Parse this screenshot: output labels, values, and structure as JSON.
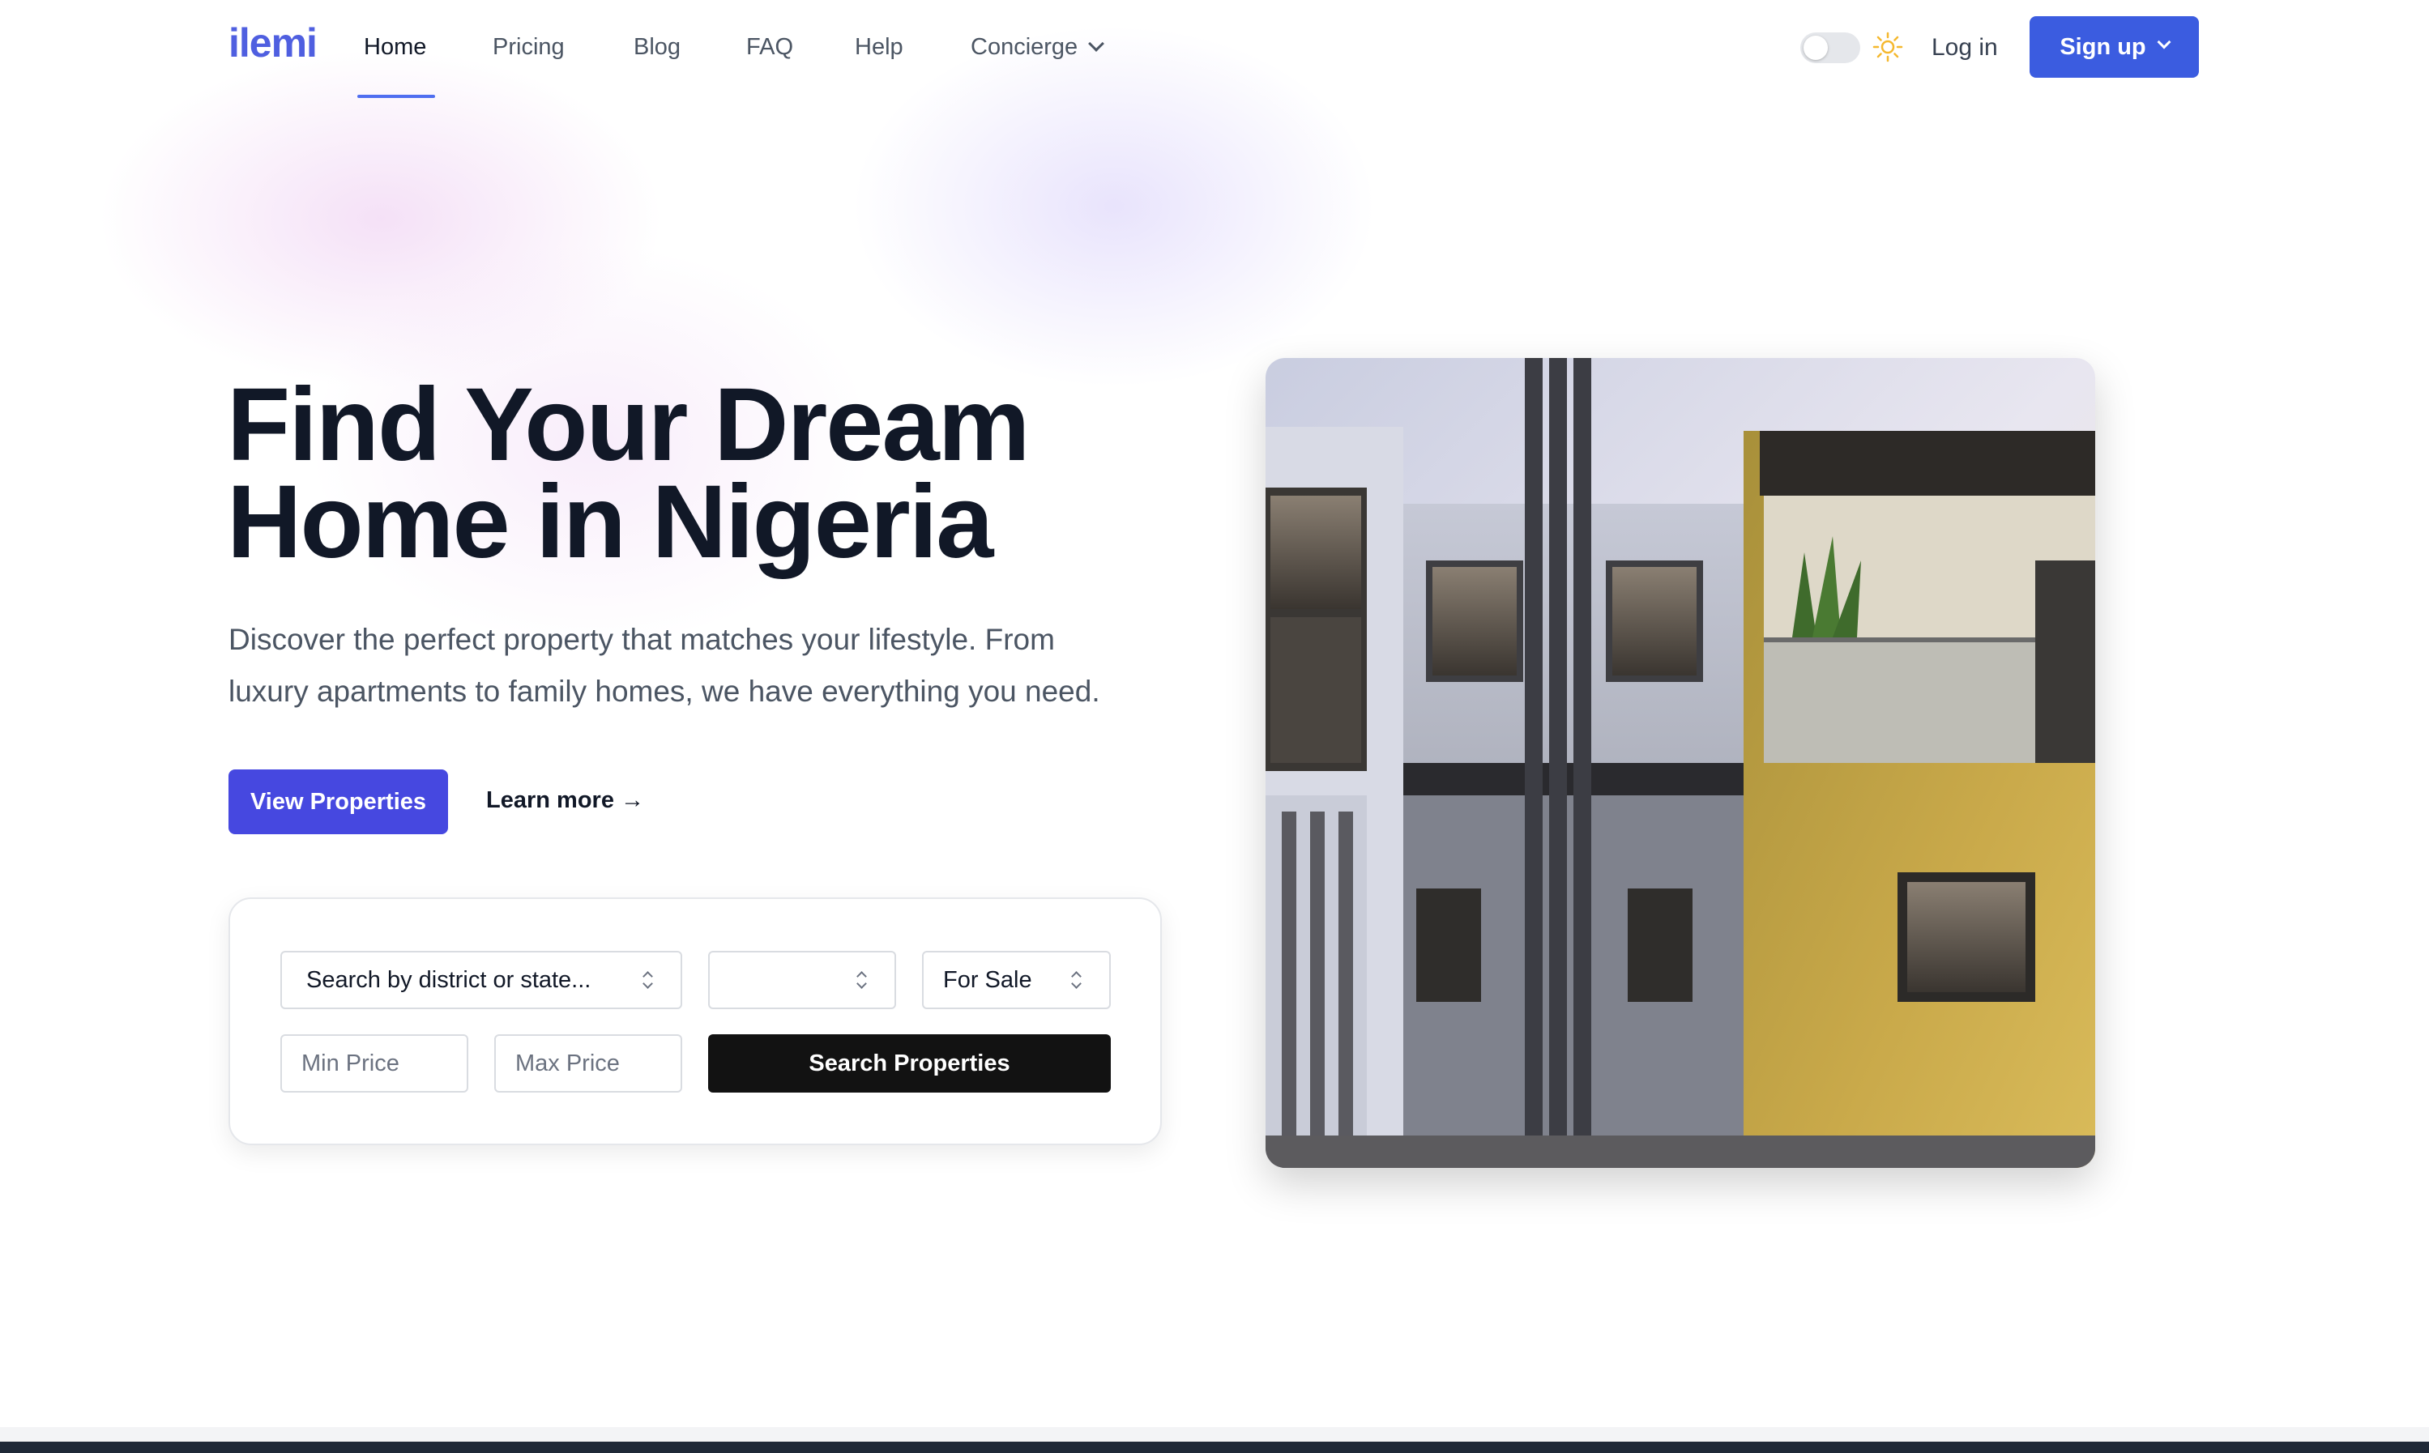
{
  "brand": {
    "logo": "ilemi",
    "accent": "#3b5ce0"
  },
  "nav": {
    "items": [
      {
        "label": "Home",
        "active": true
      },
      {
        "label": "Pricing"
      },
      {
        "label": "Blog"
      },
      {
        "label": "FAQ"
      },
      {
        "label": "Help"
      },
      {
        "label": "Concierge",
        "dropdown": true
      }
    ],
    "theme_toggle": {
      "state": "off",
      "icon": "sun-icon"
    },
    "login_label": "Log in",
    "signup_label": "Sign up"
  },
  "hero": {
    "title_line1": "Find Your Dream",
    "title_line2": "Home in Nigeria",
    "subtitle_line1": "Discover the perfect property that matches your lifestyle. From",
    "subtitle_line2": "luxury apartments to family homes, we have everything you need.",
    "primary_cta": "View Properties",
    "secondary_cta": "Learn more →",
    "primary_color": "#4648e0"
  },
  "search": {
    "location": {
      "value": "Search by district or state..."
    },
    "type": {
      "value": ""
    },
    "listing": {
      "value": "For Sale"
    },
    "min_price": {
      "placeholder": "Min Price"
    },
    "max_price": {
      "placeholder": "Max Price"
    },
    "submit_label": "Search Properties"
  }
}
